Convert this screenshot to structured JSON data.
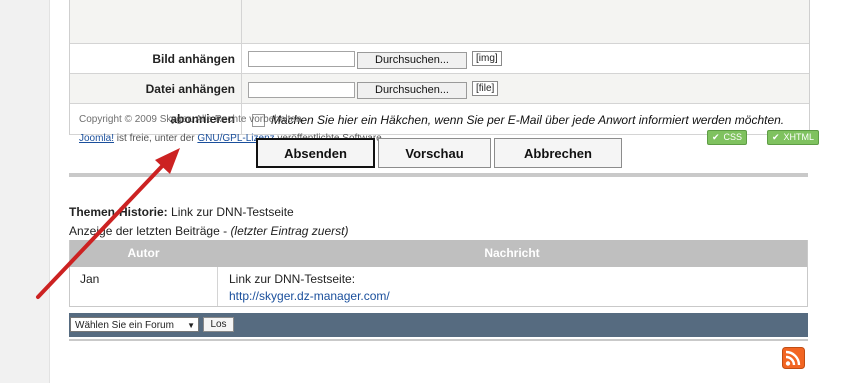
{
  "form": {
    "bild_label": "Bild anhängen",
    "datei_label": "Datei anhängen",
    "abo_label": "abonnieren",
    "browse_label": "Durchsuchen...",
    "img_tag": "[img]",
    "file_tag": "[file]",
    "abo_text": "Machen Sie hier ein Häkchen, wenn Sie per E-Mail über jede Anwort informiert werden möchten."
  },
  "footer": {
    "copyright": "Copyright © 2009 Skyger. Alle Rechte vorbehalten.",
    "license_prefix": "Joomla!",
    "license_mid": " ist freie, unter der ",
    "license_link": "GNU/GPL-Lizenz",
    "license_suffix": " veröffentlichte Software."
  },
  "badges": {
    "css": "CSS",
    "xhtml": "XHTML"
  },
  "buttons": {
    "submit": "Absenden",
    "preview": "Vorschau",
    "cancel": "Abbrechen"
  },
  "history": {
    "title_bold": "Themen-Historie:",
    "title_text": " Link zur DNN-Testseite",
    "subtitle": "Anzeige der letzten Beiträge - ",
    "subtitle_italic": "(letzter Eintrag zuerst)",
    "col_author": "Autor",
    "col_message": "Nachricht",
    "rows": [
      {
        "author": "Jan",
        "message_title": "Link zur DNN-Testseite:",
        "message_link": "http://skyger.dz-manager.com/"
      }
    ]
  },
  "forum_nav": {
    "select_value": "Wählen Sie ein Forum",
    "go_label": "Los"
  },
  "icons": {
    "rss": "rss-icon",
    "arrow": "red-arrow",
    "check": "checkmark-icon",
    "dropdown": "chevron-down-icon"
  },
  "colors": {
    "arrow": "#cc2222",
    "badge": "#7fc25f",
    "forum_bar": "#566b80",
    "rss": "#f26522"
  }
}
